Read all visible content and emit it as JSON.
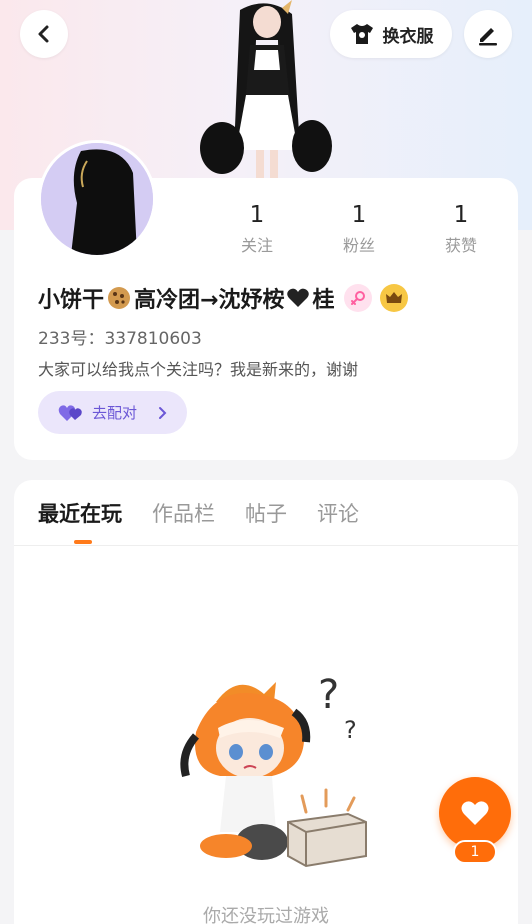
{
  "header": {
    "back_icon": "chevron-left-icon",
    "outfit_label": "换衣服",
    "outfit_icon": "tshirt-icon",
    "edit_icon": "pen-icon"
  },
  "profile": {
    "stats": [
      {
        "num": "1",
        "label": "关注"
      },
      {
        "num": "1",
        "label": "粉丝"
      },
      {
        "num": "1",
        "label": "获赞"
      }
    ],
    "name_part1": "小饼干",
    "name_part2": "高冷团→沈妤桉",
    "name_part3": "桂",
    "uid": "233号：337810603",
    "bio": "大家可以给我点个关注吗？我是新来的，谢谢",
    "pair_label": "去配对",
    "badges": [
      "female-icon",
      "crown-icon"
    ],
    "colors": {
      "female_badge": "#ffe1ee",
      "crown_badge": "#f7c744",
      "pair_accent": "#6b57d6"
    }
  },
  "tabs": {
    "items": [
      "最近在玩",
      "作品栏",
      "帖子",
      "评论"
    ],
    "active_index": 0,
    "accent": "#ff7a1a"
  },
  "empty": {
    "text": "你还没玩过游戏"
  },
  "like": {
    "count": "1",
    "icon": "heart-icon",
    "color": "#ff6d0a"
  }
}
